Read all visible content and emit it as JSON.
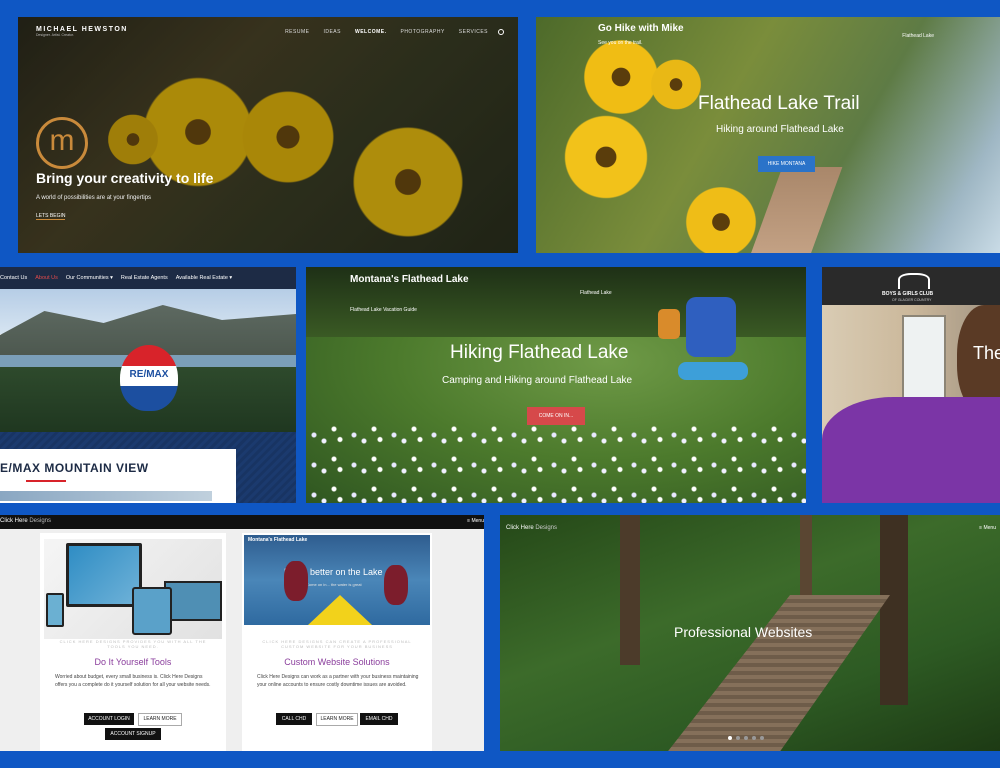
{
  "p1": {
    "logo": "MICHAEL HEWSTON",
    "logo_sub": "Designer. Artist. Creator.",
    "nav": [
      "RESUME",
      "IDEAS",
      "WELCOME.",
      "PHOTOGRAPHY",
      "SERVICES"
    ],
    "headline": "Bring your creativity to life",
    "sub": "A world of possibilities are at your fingertips",
    "cta": "LETS BEGIN"
  },
  "p2": {
    "brand": "Go Hike with Mike",
    "brand_sub": "See you on the trail.",
    "top_right": "Flathead Lake",
    "title": "Flathead Lake Trail",
    "subtitle": "Hiking around Flathead Lake",
    "cta": "HIKE MONTANA"
  },
  "p3": {
    "nav": [
      "Contact Us",
      "About Us",
      "Our Communities ▾",
      "Real Estate Agents",
      "Available Real Estate ▾"
    ],
    "balloon_text": "RE/MAX",
    "heading": "E/MAX MOUNTAIN VIEW"
  },
  "p4": {
    "brand": "Montana's Flathead Lake",
    "brand_sub": "Flathead Lake Vacation Guide",
    "top_right": "Flathead Lake",
    "title": "Hiking Flathead Lake",
    "subtitle": "Camping and Hiking around Flathead Lake",
    "cta": "COME ON IN..."
  },
  "p5": {
    "logo_line1": "BOYS & GIRLS CLUB",
    "logo_line2": "OF GLACIER COUNTRY",
    "headline": "The"
  },
  "p6": {
    "brand": "Click Here",
    "brand_suffix": "Designs",
    "menu": "≡ Menu",
    "left": {
      "tagline": "CLICK HERE DESIGNS PROVIDES YOU WITH ALL THE TOOLS YOU NEED.",
      "title": "Do It Yourself Tools",
      "body": "Worried about budget, every small business is. Click Here Designs offers you a complete do it yourself solution for all your website needs.",
      "btn1": "ACCOUNT LOGIN",
      "btn2": "LEARN MORE",
      "btn3": "ACCOUNT SIGNUP"
    },
    "right": {
      "thumb_brand": "Montana's Flathead Lake",
      "thumb_title": "Life is better on the Lake",
      "thumb_sub": "Come on in... the water is great",
      "tagline": "CLICK HERE DESIGNS CAN CREATE A PROFESSIONAL CUSTOM WEBSITE FOR YOUR BUSINESS",
      "title": "Custom Website Solutions",
      "body": "Click Here Designs can work as a partner with your business maintaining your online accounts to ensure costly downtime issues are avoided.",
      "btn1": "CALL CHD",
      "btn2": "LEARN MORE",
      "btn3": "EMAIL CHD"
    }
  },
  "p7": {
    "brand": "Click Here",
    "brand_suffix": "Designs",
    "menu": "≡ Menu",
    "title": "Professional Websites",
    "dots": 5
  },
  "colors": {
    "background": "#0f57c4",
    "accent_purple": "#8a3d9c",
    "remax_red": "#d8232a",
    "cta_red": "#d6494a",
    "cta_blue": "#2a73c9"
  }
}
